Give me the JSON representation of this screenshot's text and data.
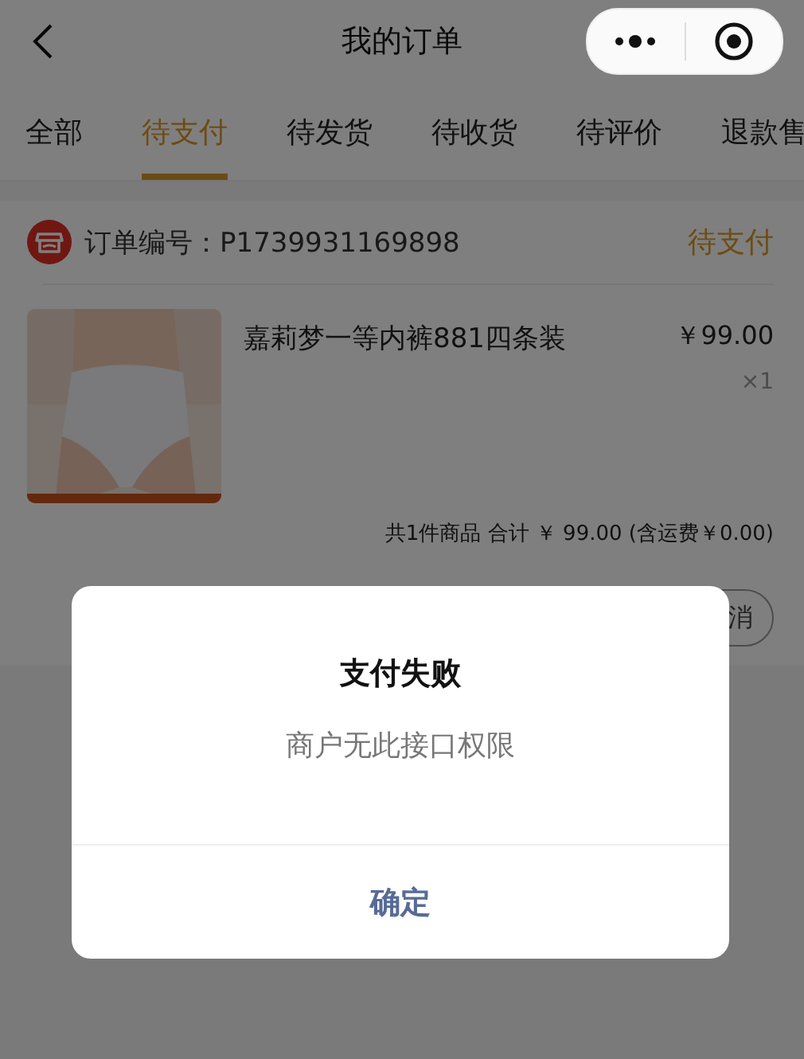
{
  "nav": {
    "title": "我的订单"
  },
  "tabs": [
    {
      "label": "全部",
      "selected": false
    },
    {
      "label": "待支付",
      "selected": true
    },
    {
      "label": "待发货",
      "selected": false
    },
    {
      "label": "待收货",
      "selected": false
    },
    {
      "label": "待评价",
      "selected": false
    },
    {
      "label": "退款售",
      "selected": false
    }
  ],
  "order": {
    "number_label": "订单编号：P1739931169898",
    "status": "待支付",
    "items": [
      {
        "name": "嘉莉梦一等内裤881四条装",
        "price": "￥99.00",
        "quantity": "×1"
      }
    ],
    "summary": "共1件商品 合计 ￥ 99.00 (含运费￥0.00)",
    "buttons": [
      "消"
    ]
  },
  "dialog": {
    "title": "支付失败",
    "message": "商户无此接口权限",
    "confirm": "确定"
  }
}
